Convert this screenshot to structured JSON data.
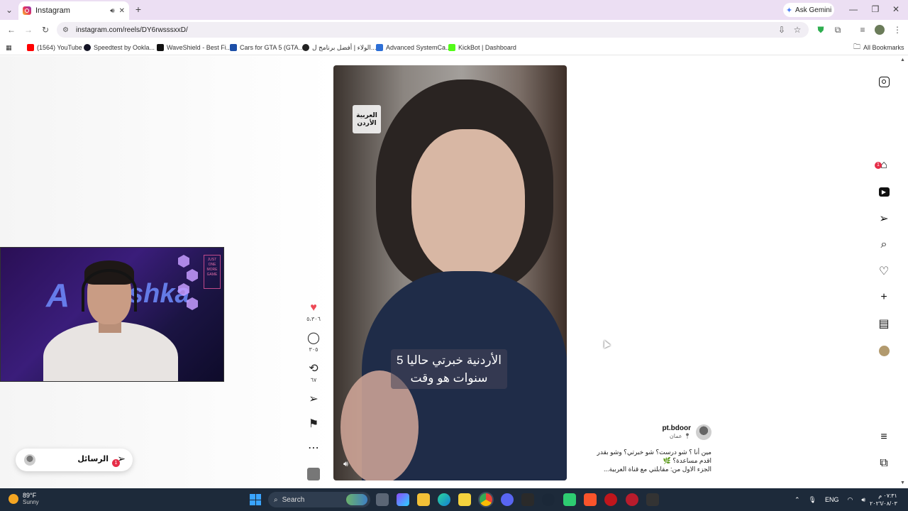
{
  "browser": {
    "tab_title": "Instagram",
    "gemini_label": "Ask Gemini",
    "url": "instagram.com/reels/DY6rwsssxxD/",
    "bookmarks": [
      {
        "label": "(1564) YouTube",
        "color": "#ff0000"
      },
      {
        "label": "Speedtest by Ookla...",
        "color": "#141526"
      },
      {
        "label": "WaveShield - Best Fi...",
        "color": "#111111"
      },
      {
        "label": "Cars for GTA 5 (GTA...",
        "color": "#1d4fa8"
      },
      {
        "label": "الولاء | أفضل برنامج ل...",
        "color": "#222222"
      },
      {
        "label": "Advanced SystemCa...",
        "color": "#2d6fd6"
      },
      {
        "label": "KickBot | Dashboard",
        "color": "#53fc18"
      }
    ],
    "all_bookmarks_label": "All Bookmarks"
  },
  "reel": {
    "video_logo_line1": "العربية",
    "video_logo_line2": "الأردن",
    "caption_line1": "الأردنية خبرتي حاليا 5",
    "caption_line2": "سنوات هو وقت",
    "likes": "٥،٣٠٦",
    "comments": "٣٠٥",
    "reposts": "٦٧"
  },
  "post": {
    "username": "pt.bdoor",
    "location": "عمان",
    "caption_line1": "مين أنا ؟ شو درست؟ شو خبرتي؟ وشو بقدر",
    "caption_line2": "اقدم مساعدة؟ 🌿",
    "caption_line3": "الجزء الاول من: مقابلتي مع قناة العربية..."
  },
  "nav": {
    "messages_badge": "1"
  },
  "messages_pill": {
    "label": "الرسائل",
    "badge": "1"
  },
  "webcam": {
    "sign_text": "JUST ONE MORE GAME",
    "neon_text_left": "A",
    "neon_text_right": "shka"
  },
  "taskbar": {
    "temperature": "89°F",
    "condition": "Sunny",
    "search_label": "Search",
    "language": "ENG",
    "time": "٠٧:٣١ م",
    "date": "٢٠٢٦/٠٨/٠٣"
  }
}
